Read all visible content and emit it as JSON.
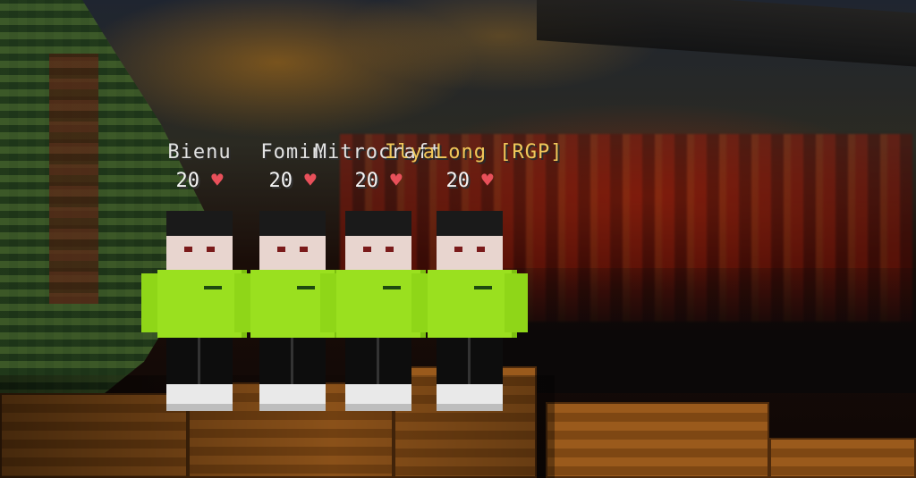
{
  "players": [
    {
      "name": "Bienu",
      "health": "20",
      "heart_icon": "heart-icon"
    },
    {
      "name": "Fomin",
      "health": "20",
      "heart_icon": "heart-icon"
    },
    {
      "name": "Mitrocraft",
      "health": "20",
      "heart_icon": "heart-icon"
    },
    {
      "name": "IlyaLong [RGP]",
      "health": "20",
      "heart_icon": "heart-icon"
    }
  ],
  "heart_glyph": "♥",
  "colors": {
    "health_heart": "#e8505a",
    "nametag_text": "#e2e2e2",
    "hoodie_green": "#9ae01f",
    "lava": "#a0190a"
  }
}
